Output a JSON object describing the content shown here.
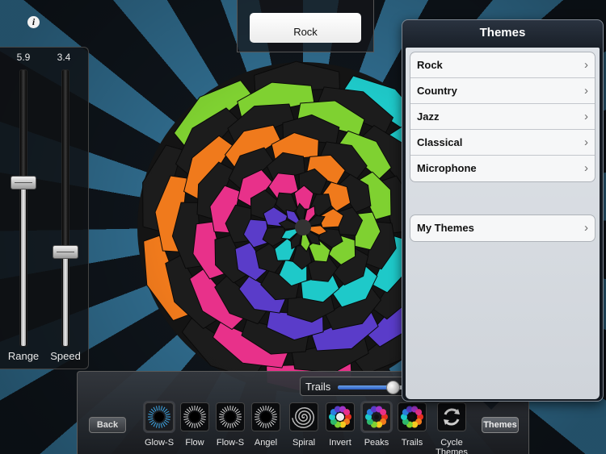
{
  "window": {
    "current_theme": "Rock"
  },
  "info": {
    "icon": "info-icon",
    "glyph": "i"
  },
  "sliders": {
    "range": {
      "value_text": "5.9",
      "label": "Range",
      "level": 0.59
    },
    "speed": {
      "value_text": "3.4",
      "label": "Speed",
      "level": 0.34
    }
  },
  "toolbar": {
    "back_label": "Back",
    "trails_label": "Trails",
    "trails_level": 0.62,
    "themes_label": "Themes",
    "modes": [
      {
        "label": "Glow-S",
        "icon": "glow-spiral-icon",
        "active": true
      },
      {
        "label": "Flow",
        "icon": "flow-icon"
      },
      {
        "label": "Flow-S",
        "icon": "flow-spiral-icon"
      },
      {
        "label": "Angel",
        "icon": "angel-icon"
      },
      {
        "label": "Spiral",
        "icon": "spiral-icon"
      },
      {
        "label": "Invert",
        "icon": "invert-icon"
      },
      {
        "label": "Peaks",
        "icon": "peaks-icon",
        "active": true
      },
      {
        "label": "Trails",
        "icon": "trails-icon"
      },
      {
        "label": "Cycle Themes",
        "icon": "cycle-icon"
      }
    ]
  },
  "themes_popover": {
    "title": "Themes",
    "items": [
      "Rock",
      "Country",
      "Jazz",
      "Classical",
      "Microphone"
    ],
    "custom": [
      "My Themes"
    ],
    "chevron": "›"
  },
  "colors": {
    "spectrum": [
      "#e8311f",
      "#f07a1c",
      "#f5c91f",
      "#7fd131",
      "#2eb86a",
      "#1ec9c9",
      "#2a7fe0",
      "#5a3cc9",
      "#a234c8",
      "#e8318a"
    ],
    "ray_light": "#2f6a8b",
    "ray_dark": "#0e141a",
    "popover_header": "#1b222c",
    "trails_fill": "#3a70d6"
  }
}
